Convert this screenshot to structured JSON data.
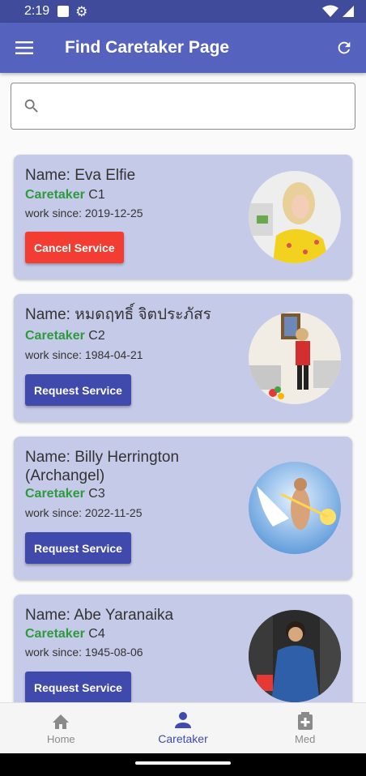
{
  "status": {
    "time": "2:19"
  },
  "app_bar": {
    "title": "Find Caretaker Page"
  },
  "search": {
    "placeholder": "",
    "value": ""
  },
  "caretakers": [
    {
      "name": "Name: Eva Elfie",
      "role": "Caretaker",
      "code": "C1",
      "since": "work since: 2019-12-25",
      "action": "Cancel Service"
    },
    {
      "name": "Name: หมดฤทธิ์ จิตประภัสร",
      "role": "Caretaker",
      "code": "C2",
      "since": "work since: 1984-04-21",
      "action": "Request Service"
    },
    {
      "name": "Name: Billy Herrington (Archangel)",
      "role": "Caretaker",
      "code": "C3",
      "since": "work since: 2022-11-25",
      "action": "Request Service"
    },
    {
      "name": "Name: Abe Yaranaika",
      "role": "Caretaker",
      "code": "C4",
      "since": "work since: 1945-08-06",
      "action": "Request Service"
    }
  ],
  "nav": {
    "home": "Home",
    "caretaker": "Caretaker",
    "med": "Med"
  },
  "colors": {
    "app_bar": "#5562be",
    "status_bar": "#414b9c",
    "card": "#c6cae9",
    "role_green": "#2e9a3e",
    "cancel_red": "#f33d32",
    "request_blue": "#3f4aac"
  },
  "icons": {
    "menu": "menu-icon",
    "refresh": "refresh-icon",
    "search": "search-icon",
    "home": "home-icon",
    "caretaker": "person-icon",
    "med": "medical-icon"
  }
}
